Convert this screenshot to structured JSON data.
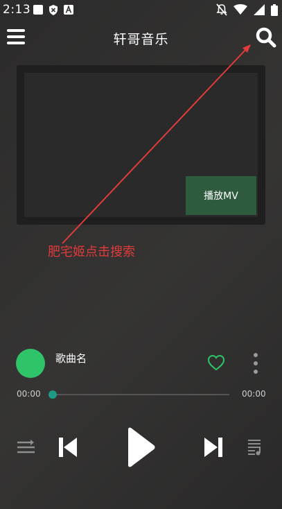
{
  "status_bar": {
    "time": "2:13",
    "icons": [
      "notification-square-icon",
      "shield-x-icon",
      "font-a-icon",
      "mute-icon",
      "wifi-icon",
      "signal-icon",
      "battery-icon"
    ]
  },
  "header": {
    "title": "轩哥音乐",
    "menu_icon": "menu-icon",
    "search_icon": "search-icon"
  },
  "mv": {
    "button_label": "播放MV"
  },
  "annotation": {
    "text": "肥宅姬点击搜索",
    "color": "#e23b3b"
  },
  "now_playing": {
    "song_name": "歌曲名",
    "cover_color": "#2fc46a",
    "current_time": "00:00",
    "total_time": "00:00",
    "progress": 0,
    "favorite_icon": "heart-outline-icon",
    "more_icon": "more-vertical-icon"
  },
  "controls": [
    "shuffle-list-icon",
    "previous-icon",
    "play-icon",
    "next-icon",
    "playlist-icon"
  ],
  "colors": {
    "accent_green": "#2fc46a",
    "mv_button": "#2e5a3e",
    "progress_thumb": "#1e9a86",
    "background": "#323131"
  }
}
